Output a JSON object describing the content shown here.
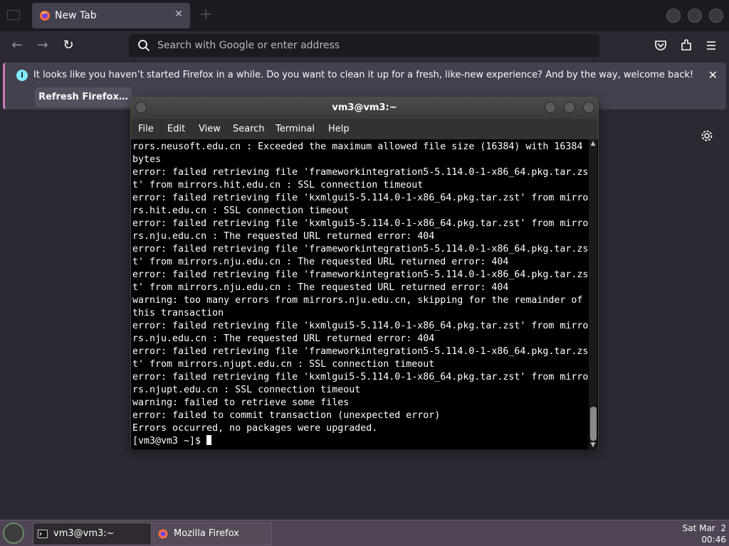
{
  "browser": {
    "tab": {
      "title": "New Tab",
      "close_glyph": "✕"
    },
    "urlbar": {
      "placeholder": "Search with Google or enter address"
    },
    "nav": {
      "back": "←",
      "forward": "→",
      "reload": "↻"
    },
    "notification": {
      "message": "It looks like you haven’t started Firefox in a while. Do you want to clean it up for a fresh, like-new experience? And by the way, welcome back!",
      "button_label": "Refresh Firefox…",
      "close_glyph": "✕",
      "info_glyph": "i"
    },
    "icons": [
      "search-icon",
      "pocket-icon",
      "extensions-icon",
      "menu-icon",
      "settings-gear-icon"
    ],
    "accent": "#c97ab8"
  },
  "terminal": {
    "title": "vm3@vm3:~",
    "menu": [
      "File",
      "Edit",
      "View",
      "Search",
      "Terminal",
      "Help"
    ],
    "lines": [
      "rors.neusoft.edu.cn : Exceeded the maximum allowed file size (16384) with 16384",
      "bytes",
      "error: failed retrieving file 'frameworkintegration5-5.114.0-1-x86_64.pkg.tar.zs",
      "t' from mirrors.hit.edu.cn : SSL connection timeout",
      "error: failed retrieving file 'kxmlgui5-5.114.0-1-x86_64.pkg.tar.zst' from mirro",
      "rs.hit.edu.cn : SSL connection timeout",
      "error: failed retrieving file 'kxmlgui5-5.114.0-1-x86_64.pkg.tar.zst' from mirro",
      "rs.nju.edu.cn : The requested URL returned error: 404",
      "error: failed retrieving file 'frameworkintegration5-5.114.0-1-x86_64.pkg.tar.zs",
      "t' from mirrors.nju.edu.cn : The requested URL returned error: 404",
      "error: failed retrieving file 'frameworkintegration5-5.114.0-1-x86_64.pkg.tar.zs",
      "t' from mirrors.nju.edu.cn : The requested URL returned error: 404",
      "warning: too many errors from mirrors.nju.edu.cn, skipping for the remainder of",
      "this transaction",
      "error: failed retrieving file 'kxmlgui5-5.114.0-1-x86_64.pkg.tar.zst' from mirro",
      "rs.nju.edu.cn : The requested URL returned error: 404",
      "error: failed retrieving file 'frameworkintegration5-5.114.0-1-x86_64.pkg.tar.zs",
      "t' from mirrors.njupt.edu.cn : SSL connection timeout",
      "error: failed retrieving file 'kxmlgui5-5.114.0-1-x86_64.pkg.tar.zst' from mirro",
      "rs.njupt.edu.cn : SSL connection timeout",
      "warning: failed to retrieve some files",
      "error: failed to commit transaction (unexpected error)",
      "Errors occurred, no packages were upgraded.",
      "[vm3@vm3 ~]$ "
    ]
  },
  "taskbar": {
    "items": [
      {
        "label": "vm3@vm3:~",
        "icon": "terminal-icon",
        "active": true
      },
      {
        "label": "Mozilla Firefox",
        "icon": "firefox-icon",
        "active": false
      }
    ],
    "clock": {
      "date": "Sat Mar  2",
      "time": "00:46"
    }
  }
}
